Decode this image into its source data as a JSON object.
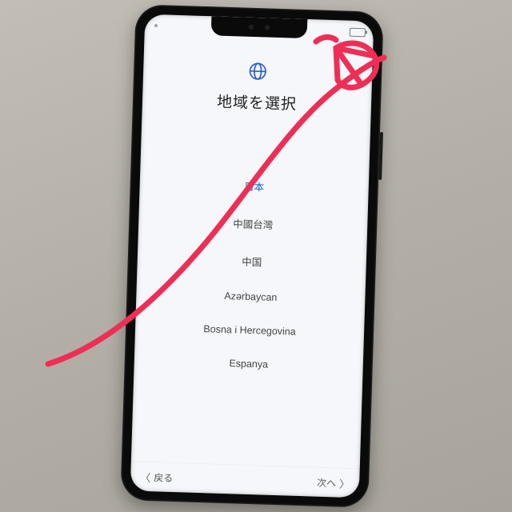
{
  "status": {
    "battery_icon": "battery-icon"
  },
  "header": {
    "icon": "globe-icon",
    "title": "地域を選択"
  },
  "regions": [
    {
      "label": "日本",
      "selected": true
    },
    {
      "label": "中國台灣",
      "selected": false
    },
    {
      "label": "中国",
      "selected": false
    },
    {
      "label": "Azərbaycan",
      "selected": false
    },
    {
      "label": "Bosna i Hercegovina",
      "selected": false
    },
    {
      "label": "Espanya",
      "selected": false
    }
  ],
  "footer": {
    "back_label": "戻る",
    "next_label": "次へ",
    "back_chevron": "〈",
    "next_chevron": "〉"
  },
  "annotation": {
    "color": "#ef2e55"
  }
}
